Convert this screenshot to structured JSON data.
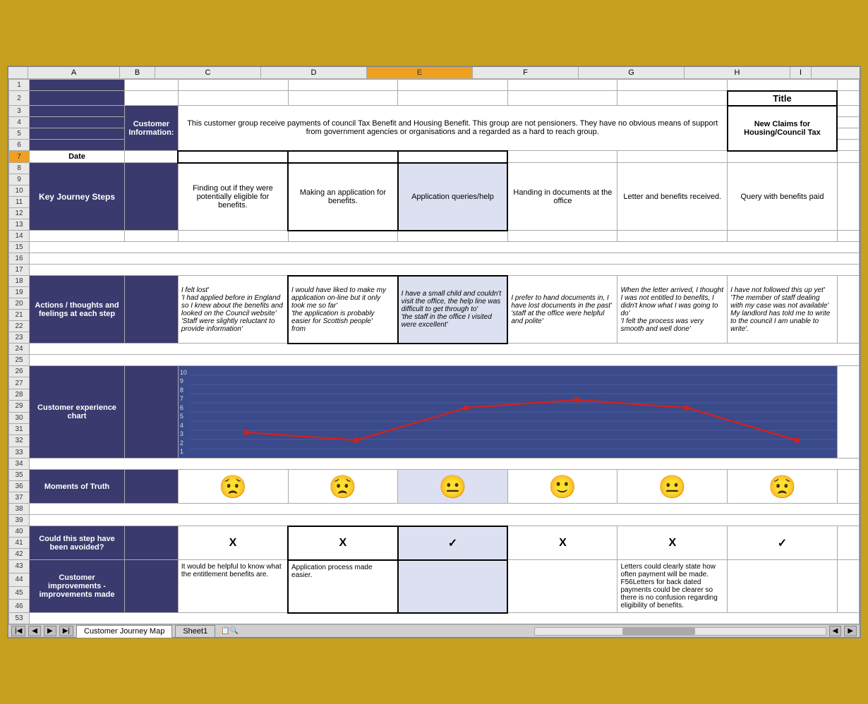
{
  "tabs": {
    "active": "Customer Journey Map",
    "inactive": "Sheet1"
  },
  "columns": {
    "headers": [
      "A",
      "B",
      "C",
      "D",
      "E",
      "F",
      "G",
      "H",
      "I"
    ]
  },
  "title": {
    "label": "Title",
    "value": "New Claims for Housing/Council Tax"
  },
  "customer_info": {
    "label": "Customer Information:",
    "text": "This customer group receive payments of council Tax Benefit and Housing Benefit. This group are not pensioners. They have no obvious means of support from government agencies or organisations and a regarded as a hard to reach group."
  },
  "date": {
    "label": "Date"
  },
  "key_journey": {
    "label": "Key Journey Steps",
    "steps": [
      "Finding out if they were potentially eligible for benefits.",
      "Making an application for benefits.",
      "Application queries/help",
      "Handing in documents at the office",
      "Letter and benefits received.",
      "Query with benefits paid"
    ]
  },
  "actions": {
    "label": "Actions / thoughts and feelings at each step",
    "texts": [
      "I felt lost'\n'I had applied before in England so I knew about the benefits and looked on the Council website'\n'Staff were slightly reluctant to provide information'",
      "I would have liked to make my application on-line but it only took me so far'\n'the application is probably easier for Scottish people'\nfrom",
      "I have a small child and couldn't visit the office, the help line was difficult to get through to'\n'the staff in the office I visited were excellent'",
      "I prefer to hand documents in, I have lost documents in the past'\n'staff at the office were helpful and polite'",
      "When the letter arrived, I thought I was not entitled to benefits, I didn't know what I was going to do'\n'I felt the process was very smooth and well done'",
      "I have not followed this up yet'\n'The member of staff dealing with my case was not available' My landlord has told me to write to the council I am unable to write'."
    ]
  },
  "chart": {
    "label": "Customer experience chart",
    "y_axis": [
      "10",
      "9",
      "8",
      "7",
      "6",
      "5",
      "4",
      "3",
      "2",
      "1"
    ],
    "points": [
      {
        "step": 0,
        "value": 3
      },
      {
        "step": 1,
        "value": 2
      },
      {
        "step": 2,
        "value": 6
      },
      {
        "step": 3,
        "value": 7
      },
      {
        "step": 4,
        "value": 6
      },
      {
        "step": 5,
        "value": 2
      }
    ]
  },
  "moments": {
    "label": "Moments of Truth",
    "emojis": [
      "sad",
      "sad",
      "neutral",
      "happy",
      "neutral",
      "sad"
    ]
  },
  "avoid": {
    "label": "Could this step have been avoided?",
    "values": [
      "X",
      "X",
      "✓",
      "X",
      "X",
      "✓"
    ]
  },
  "improvements": {
    "label": "Customer improvements - improvements made",
    "texts": [
      "It would be helpful to know what the entitlement benefits are.",
      "Application process made easier.",
      "",
      "",
      "Letters could clearly state how often payment will be made.\nF56Letters for back dated payments could be clearer so there is no confusion regarding eligibility of benefits.",
      ""
    ]
  }
}
